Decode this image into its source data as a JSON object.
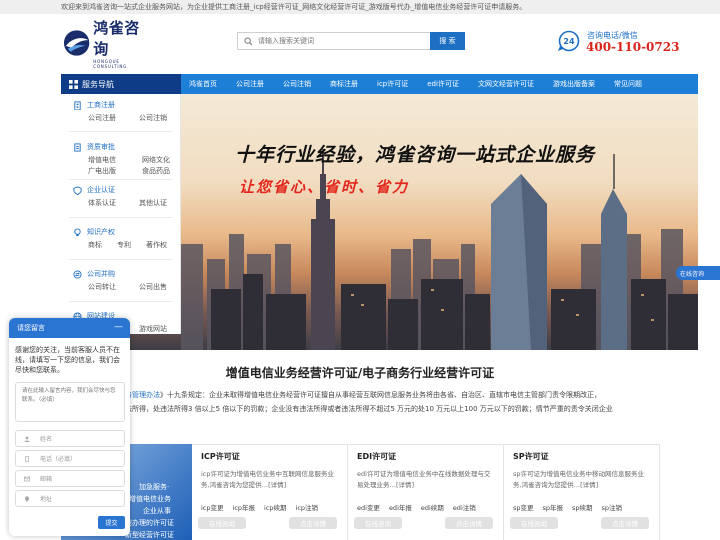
{
  "topbar": {
    "text": "欢迎来到鸿雀咨询一站式企业服务网站，为企业提供工商注册_icp经营许可证_网络文化经营许可证_游戏版号代办_增值电信业务经营许可证申请服务。"
  },
  "header": {
    "logo_cn": "鸿雀咨询",
    "logo_en": "HONGQUE CONSULTING",
    "search_placeholder": "请输入搜索关键词",
    "search_button": "搜 索",
    "phone_badge": "24",
    "phone_label": "咨询电话/微信",
    "phone_number": "400-110-0723"
  },
  "nav": {
    "service_label": "服务导航",
    "items": [
      "鸿雀首页",
      "公司注册",
      "公司注销",
      "商标注册",
      "icp许可证",
      "edi许可证",
      "文网文经营许可证",
      "游戏出版备案",
      "常见问题"
    ]
  },
  "sidemenu": {
    "groups": [
      {
        "title": "工商注册",
        "icon": "building-icon",
        "links": [
          "公司注册",
          "公司注销"
        ]
      },
      {
        "title": "资质审批",
        "icon": "document-icon",
        "links": [
          "增值电信",
          "网络文化",
          "广电出版",
          "食品药品"
        ]
      },
      {
        "title": "企业认证",
        "icon": "shield-icon",
        "links": [
          "体系认证",
          "其他认证"
        ]
      },
      {
        "title": "知识产权",
        "icon": "bulb-icon",
        "links": [
          "商标",
          "专利",
          "著作权"
        ]
      },
      {
        "title": "公司并购",
        "icon": "transfer-icon",
        "links": [
          "公司转让",
          "公司出售"
        ]
      },
      {
        "title": "网站建设",
        "icon": "globe-icon",
        "links": [
          "游戏网站"
        ]
      }
    ]
  },
  "banner": {
    "title": "十年行业经验，鸿雀咨询一站式企业服务",
    "slogan": "让您省心、省时、省力"
  },
  "online_tab": "在线咨询",
  "section": {
    "title": "增值电信业务经营许可证/电子商务行业经营许可证",
    "intro_link": "息服务管理办法",
    "intro_line1": "》十九条规定：企业未取得增值电信业务经营许可证擅自从事经营互联网信息服务业务将由各省、自治区、直辖市电信主管部门责令限期改正，",
    "intro_line2": "改违法所得，处违法所得3 倍以上5 倍以下的罚款；企业没有违法所得或者违法所得不超过5 万元的处10 万元以上100 万元以下的罚款；情节严重的责令关闭企业"
  },
  "promo": {
    "lines": [
      "加急服务·",
      "增值电信业务",
      "企业从事",
      "需办理的许可证",
      "新型经营许可证"
    ]
  },
  "cards": [
    {
      "title": "ICP许可证",
      "desc": "icp许可证为增值电信业务中互联网信息服务业务,鸿雀咨询为您提供…[详情]",
      "links": [
        "icp变更",
        "icp年报",
        "icp续期",
        "icp注销"
      ],
      "btn1": "在线咨询",
      "btn2": "点击详情"
    },
    {
      "title": "EDI许可证",
      "desc": "edi许可证为增值电信业务中在线数据处理与交易处理业务…[详情]",
      "links": [
        "edi变更",
        "edi年报",
        "edi续期",
        "edi注销"
      ],
      "btn1": "在线咨询",
      "btn2": "点击详情"
    },
    {
      "title": "SP许可证",
      "desc": "sp许可证为增值电信业务中移动网信息服务业务,鸿雀咨询为您提供…[详情]",
      "links": [
        "sp变更",
        "sp年报",
        "sp续期",
        "sp注销"
      ],
      "btn1": "在线咨询",
      "btn2": "点击详情"
    }
  ],
  "chat": {
    "title": "请您留言",
    "minimize": "—",
    "message": "感谢您的关注，当前客服人员不在线，请填写一下您的信息，我们会尽快和您联系。",
    "textarea_placeholder": "请在此输入留言内容，我们会尽快与您联系。（必填）",
    "fields": [
      {
        "placeholder": "姓名",
        "icon": "user-icon"
      },
      {
        "placeholder": "电话（必填）",
        "icon": "phone-icon"
      },
      {
        "placeholder": "邮箱",
        "icon": "mail-icon"
      },
      {
        "placeholder": "地址",
        "icon": "location-icon"
      }
    ],
    "submit": "提交"
  },
  "colors": {
    "primary": "#1e7fd6",
    "nav_dark": "#0e3c86",
    "phone_red": "#d9261c",
    "slogan_red": "#e2261b"
  }
}
